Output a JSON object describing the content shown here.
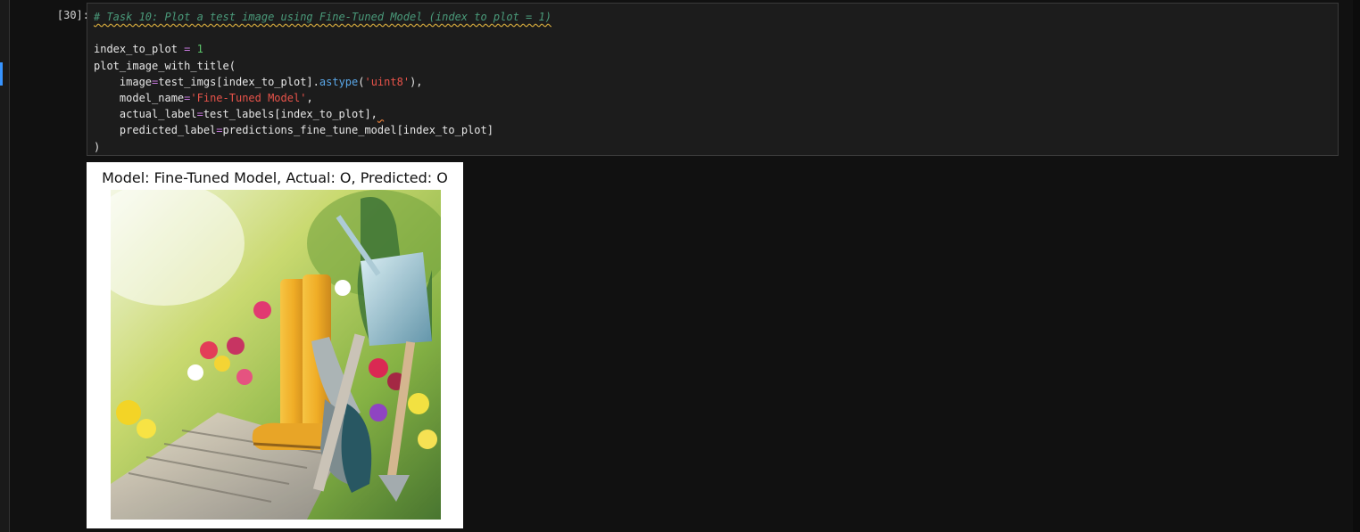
{
  "cell": {
    "prompt": "[30]:",
    "code": {
      "comment": "# Task 10: Plot a test image using Fine-Tuned Model (index to plot = 1)",
      "line_index_var": "index_to_plot",
      "line_index_eq": " = ",
      "line_index_val": "1",
      "line_call": "plot_image_with_title(",
      "arg1_name": "    image",
      "arg1_eq": "=",
      "arg1_val_a": "test_imgs[index_to_plot].",
      "arg1_method": "astype",
      "arg1_paren_open": "(",
      "arg1_str": "'uint8'",
      "arg1_paren_close": "),",
      "arg2_name": "    model_name",
      "arg2_eq": "=",
      "arg2_str": "'Fine-Tuned Model'",
      "arg2_comma": ",",
      "arg3_name": "    actual_label",
      "arg3_eq": "=",
      "arg3_val": "test_labels[index_to_plot],",
      "arg3_trailing": " ",
      "arg4_name": "    predicted_label",
      "arg4_eq": "=",
      "arg4_val": "predictions_fine_tune_model[index_to_plot]",
      "close": ")"
    }
  },
  "output": {
    "plot_title": "Model: Fine-Tuned Model, Actual: O, Predicted: O"
  },
  "colors": {
    "background": "#111111",
    "editor_bg": "#1c1c1c",
    "comment": "#4a9a7a",
    "operator": "#c678dd",
    "number": "#5cc46a",
    "string": "#e8534a",
    "method": "#5aa7e8"
  }
}
